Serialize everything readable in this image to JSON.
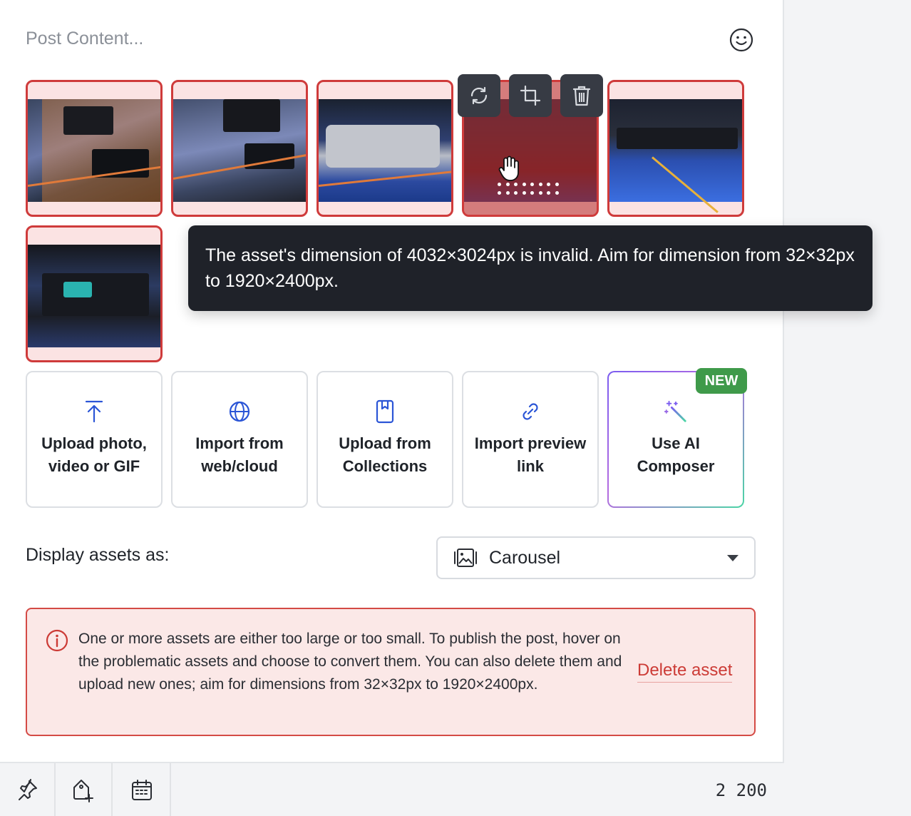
{
  "composer": {
    "post_placeholder": "Post Content...",
    "post_value": ""
  },
  "tooltip": {
    "text": "The asset's dimension of 4032×3024px is invalid. Aim for dimension from 32×32px to 1920×2400px."
  },
  "actions": [
    {
      "label": "Upload photo, video or GIF",
      "icon": "upload-arrow-icon"
    },
    {
      "label": "Import from web/cloud",
      "icon": "globe-icon"
    },
    {
      "label": "Upload from Collections",
      "icon": "bookmark-icon"
    },
    {
      "label": "Import preview link",
      "icon": "link-icon"
    },
    {
      "label": "Use AI Composer",
      "icon": "magic-wand-icon"
    }
  ],
  "new_badge": "NEW",
  "display": {
    "label": "Display assets as:",
    "selected": "Carousel"
  },
  "alert": {
    "message": "One or more assets are either too large or too small. To publish the post, hover on the problematic assets and choose to convert them. You can also delete them and upload new ones; aim for dimensions from 32×32px to 1920×2400px.",
    "delete_label": "Delete asset"
  },
  "footer": {
    "char_count": "2 200"
  },
  "colors": {
    "error_red": "#cf3b3b",
    "error_bg": "#fbe8e7",
    "accent_blue": "#2b55d6",
    "badge_green": "#3f9a4a",
    "tooltip_bg": "#1f2229"
  }
}
